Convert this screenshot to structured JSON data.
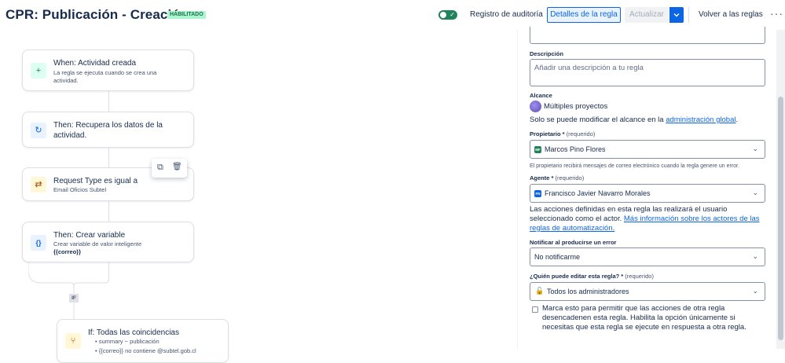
{
  "header": {
    "title": "CPR: Publicación - Creación",
    "status_badge": "HABILITADO",
    "audit_log_label": "Registro de auditoría",
    "rule_details_label": "Detalles de la regla",
    "update_label": "Actualizar",
    "back_label": "Volver a las reglas",
    "more_label": "···"
  },
  "canvas": {
    "nodes": [
      {
        "title": "When: Actividad creada",
        "subtitle": "La regla se ejecuta cuando se crea una actividad.",
        "icon": "+"
      },
      {
        "title": "Then: Recupera los datos de la actividad.",
        "icon": "↻"
      },
      {
        "title": "Request Type es igual a",
        "subtitle": "Email Oficios Subtel",
        "icon": "⇄"
      },
      {
        "title": "Then: Crear variable",
        "subtitle": "Crear variable de valor inteligente",
        "code": "{{correo}}",
        "icon": "{}"
      },
      {
        "title": "If: Todas las coincidencias",
        "conditions": [
          "summary ~ publicación",
          "{{correo}} no contiene @subtel.gob.cl"
        ],
        "icon": "⑂"
      }
    ],
    "if_label": "IF",
    "copy_icon": "⧉",
    "delete_icon": "🗑"
  },
  "panel": {
    "description_label": "Descripción",
    "description_placeholder": "Añadir una descripción a tu regla",
    "scope_label": "Alcance",
    "scope_value": "Múltiples proyectos",
    "scope_note_prefix": "Solo se puede modificar el alcance en la ",
    "scope_note_link": "administración global",
    "scope_note_suffix": ".",
    "owner_label": "Propietario *",
    "owner_required": "(requerido)",
    "owner_initials": "MF",
    "owner_value": "Marcos Pino Flores",
    "owner_note": "El propietario recibirá mensajes de correo electrónico cuando la regla genere un error.",
    "agent_label": "Agente *",
    "agent_required": "(requerido)",
    "agent_initials": "FN",
    "agent_value": "Francisco Javier Navarro Morales",
    "agent_note_text": "Las acciones definidas en esta regla las realizará el usuario seleccionado como el actor.",
    "agent_note_link": "Más información sobre los actores de las reglas de automatización.",
    "notify_label": "Notificar al producirse un error",
    "notify_value": "No notificarme",
    "editors_label": "¿Quién puede editar esta regla? *",
    "editors_required": "(requerido)",
    "editors_value": "Todos los administradores",
    "checkbox_text": "Marca esto para permitir que las acciones de otra regla desencadenen esta regla. Habilita la opción únicamente si necesitas que esta regla se ejecute en respuesta a otra regla.",
    "checkbox_checked": false
  },
  "colors": {
    "primary": "#0c66e4",
    "toggle_on": "#1f845a",
    "badge_bg": "#abf5d1"
  }
}
